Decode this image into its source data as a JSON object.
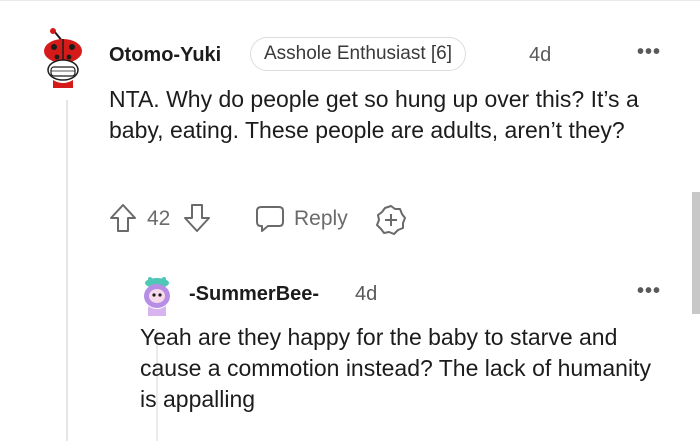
{
  "comment": {
    "username": "Otomo-Yuki",
    "flair": "Asshole Enthusiast [6]",
    "time": "4d",
    "more_label": "•••",
    "text": "NTA. Why do people get so hung up over this? It’s a baby, eating. These people are adults, aren’t they?",
    "votes": "42",
    "reply_label": "Reply",
    "avatar_icon": "snoo-ladybug-avatar",
    "icons": {
      "upvote": "upvote-arrow-icon",
      "downvote": "downvote-arrow-icon",
      "reply": "speech-bubble-icon",
      "award": "award-plus-icon"
    }
  },
  "reply": {
    "username": "-SummerBee-",
    "time": "4d",
    "more_label": "•••",
    "text": "Yeah are they happy for the baby to starve and cause a commotion instead? The lack of humanity is appalling",
    "avatar_icon": "snoo-purple-hair-avatar"
  },
  "colors": {
    "text": "#1c1c1c",
    "meta": "#595959",
    "action": "#6a6a6a",
    "divider": "#e6e6e6",
    "avatar_red": "#d51a1a"
  }
}
